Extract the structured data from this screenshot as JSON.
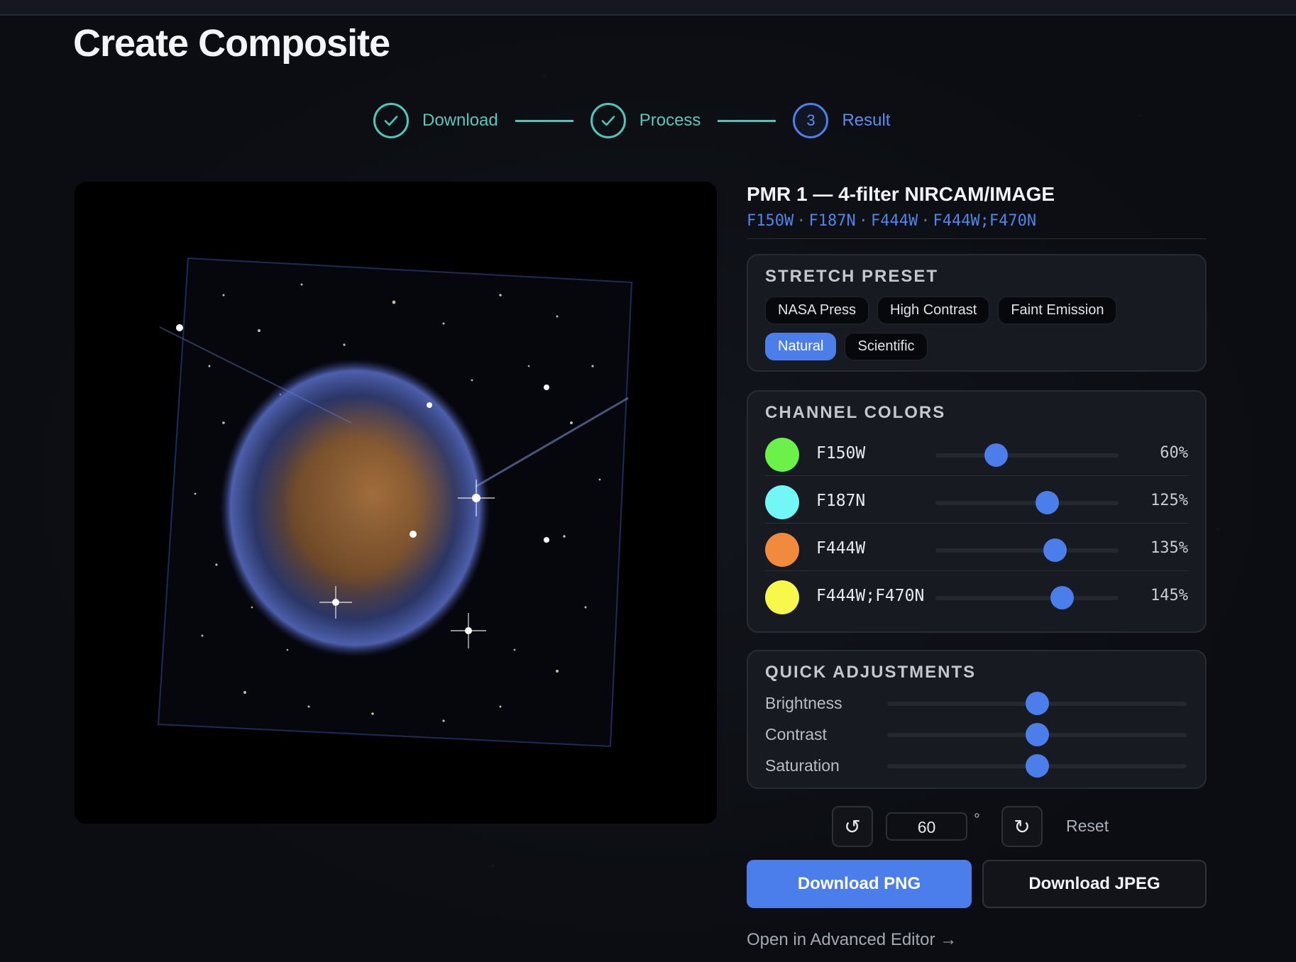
{
  "page": {
    "title": "Create Composite"
  },
  "stepper": {
    "steps": [
      {
        "label": "Download",
        "state": "done",
        "icon": "check-icon"
      },
      {
        "label": "Process",
        "state": "done",
        "icon": "check-icon"
      },
      {
        "label": "Result",
        "state": "active",
        "number": "3"
      }
    ]
  },
  "target": {
    "title": "PMR 1 — 4-filter NIRCAM/IMAGE",
    "filters": [
      "F150W",
      "F187N",
      "F444W",
      "F444W;F470N"
    ],
    "filter_separator": "·"
  },
  "stretch_preset": {
    "title": "STRETCH PRESET",
    "options": [
      "NASA Press",
      "High Contrast",
      "Faint Emission",
      "Natural",
      "Scientific"
    ],
    "selected": "Natural"
  },
  "channel_colors": {
    "title": "CHANNEL COLORS",
    "channels": [
      {
        "name": "F150W",
        "color": "#6cf14a",
        "value": "60%",
        "level": 0.33
      },
      {
        "name": "F187N",
        "color": "#72f6f6",
        "value": "125%",
        "level": 0.61
      },
      {
        "name": "F444W",
        "color": "#f08a3c",
        "value": "135%",
        "level": 0.65
      },
      {
        "name": "F444W;F470N",
        "color": "#f8f84a",
        "value": "145%",
        "level": 0.69
      }
    ]
  },
  "quick_adjustments": {
    "title": "QUICK ADJUSTMENTS",
    "sliders": [
      {
        "label": "Brightness",
        "level": 0.5
      },
      {
        "label": "Contrast",
        "level": 0.5
      },
      {
        "label": "Saturation",
        "level": 0.5
      }
    ]
  },
  "rotation": {
    "rotate_left_icon": "rotate-ccw-icon",
    "rotate_right_icon": "rotate-cw-icon",
    "rotate_left_glyph": "↺",
    "rotate_right_glyph": "↻",
    "value": "60",
    "unit": "°",
    "reset_label": "Reset"
  },
  "actions": {
    "download_png": "Download PNG",
    "download_jpeg": "Download JPEG",
    "advanced_editor": "Open in Advanced Editor →"
  },
  "colors": {
    "accent": "#4b7eea",
    "step_done": "#4fc7b8"
  }
}
